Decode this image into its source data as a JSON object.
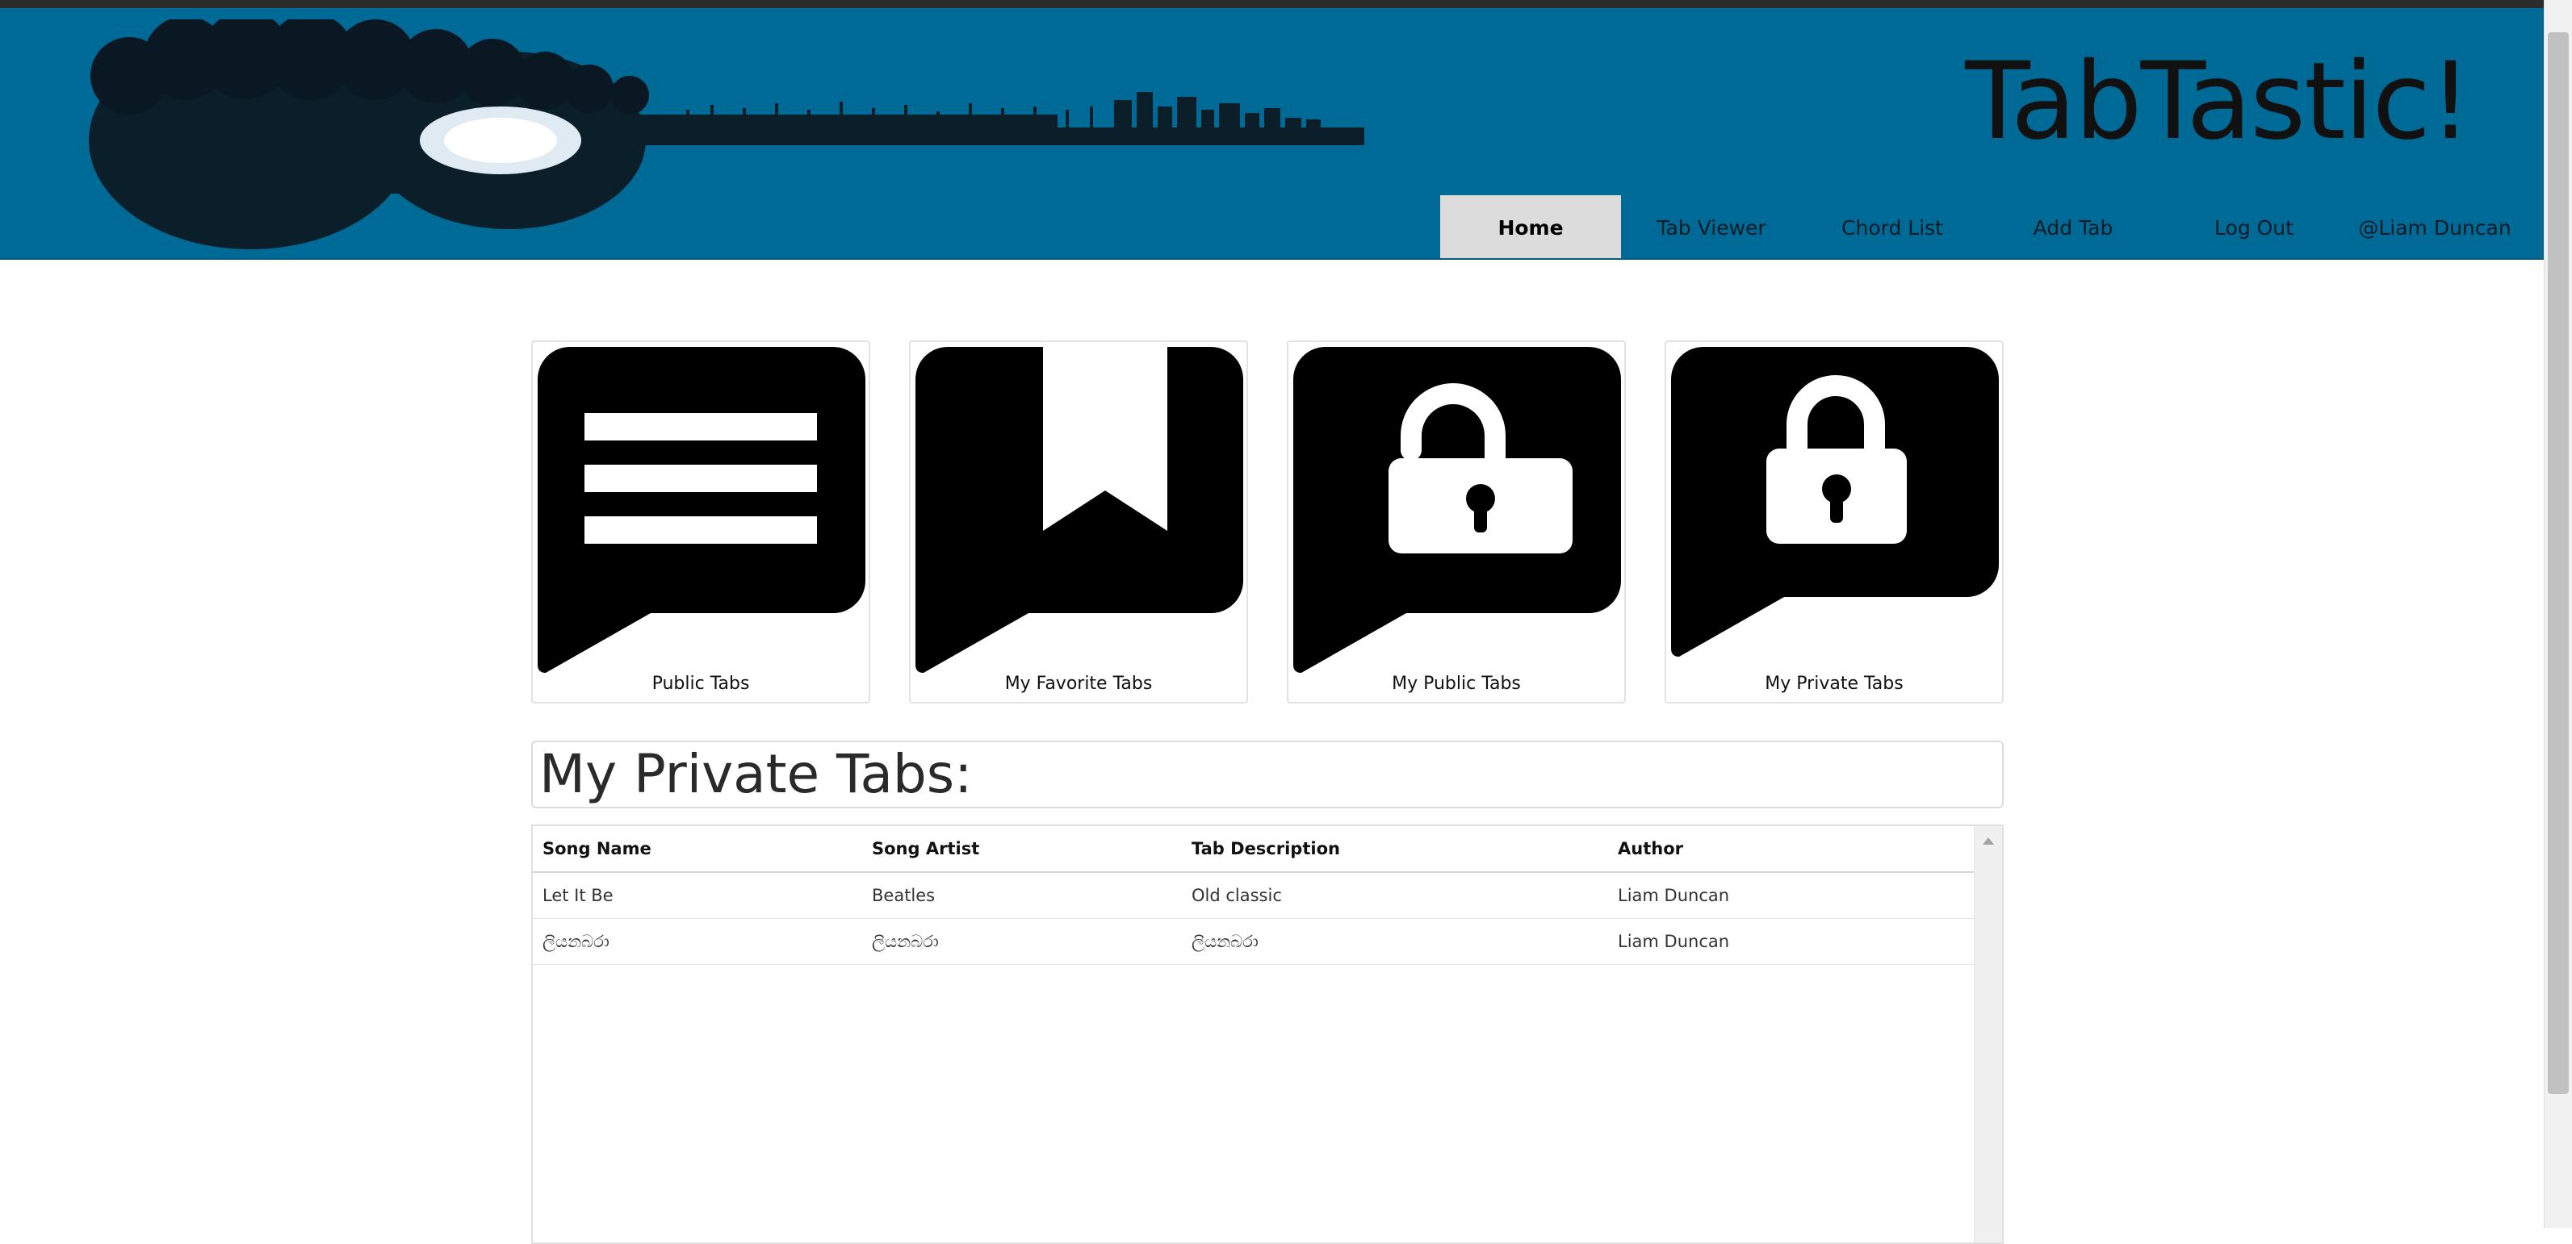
{
  "app": {
    "brand": "TabTastic!"
  },
  "nav": {
    "items": [
      {
        "label": "Home",
        "active": true
      },
      {
        "label": "Tab Viewer",
        "active": false
      },
      {
        "label": "Chord List",
        "active": false
      },
      {
        "label": "Add Tab",
        "active": false
      },
      {
        "label": "Log Out",
        "active": false
      },
      {
        "label": "@Liam Duncan",
        "active": false
      }
    ]
  },
  "cards": [
    {
      "label": "Public Tabs",
      "icon": "list-speech-bubble-icon"
    },
    {
      "label": "My Favorite Tabs",
      "icon": "bookmark-speech-bubble-icon"
    },
    {
      "label": "My Public Tabs",
      "icon": "unlocked-speech-bubble-icon"
    },
    {
      "label": "My Private Tabs",
      "icon": "locked-speech-bubble-icon"
    }
  ],
  "section": {
    "title": "My Private Tabs:"
  },
  "table": {
    "columns": [
      "Song Name",
      "Song Artist",
      "Tab Description",
      "Author"
    ],
    "rows": [
      [
        "Let It Be",
        "Beatles",
        "Old classic",
        "Liam Duncan"
      ],
      [
        "ලියනබරා",
        "ලියනබරා",
        "ලියනබරා",
        "Liam Duncan"
      ]
    ]
  },
  "colors": {
    "header": "#006a97",
    "active_nav": "#dcdcdc",
    "page": "#ffffff"
  }
}
